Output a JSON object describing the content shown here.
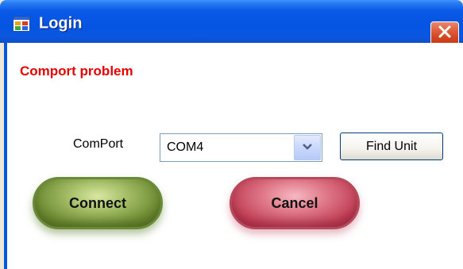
{
  "window": {
    "title": "Login",
    "icon": "app-window-icon",
    "close_icon": "close-icon"
  },
  "status": {
    "message": "Comport problem",
    "color": "#e60000"
  },
  "form": {
    "comport_label": "ComPort",
    "comport_selected": "COM4",
    "find_unit_label": "Find Unit"
  },
  "actions": {
    "connect_label": "Connect",
    "connect_color": "#6e8c34",
    "cancel_label": "Cancel",
    "cancel_color": "#bf3c53"
  },
  "colors": {
    "titlebar": "#0554e2",
    "close_button": "#d24520"
  }
}
